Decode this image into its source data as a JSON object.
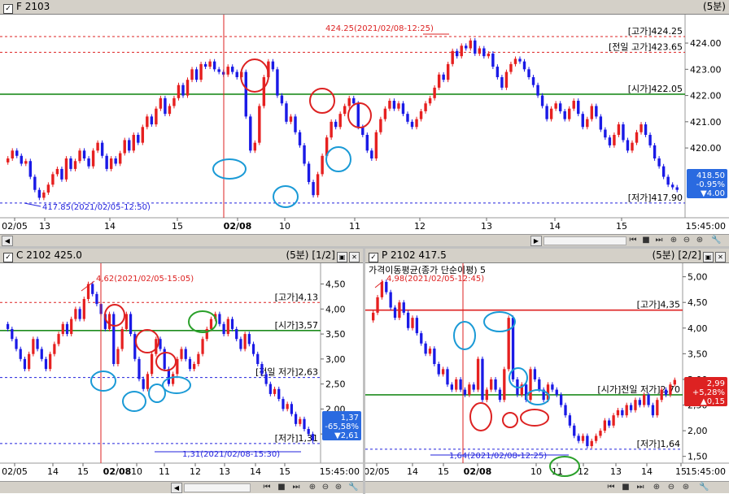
{
  "top": {
    "title": "F 2103",
    "interval": "(5분)",
    "colors": {
      "up": "#e62020",
      "down": "#1a1ae6",
      "open": "#1e8c1e",
      "high": "#dd2222",
      "low": "#2222dd"
    },
    "chart_data": {
      "type": "candlestick",
      "ylim": [
        417.4,
        424.9
      ],
      "yticks": [
        "424.00",
        "423.00",
        "422.00",
        "421.00",
        "420.00"
      ],
      "xticks": [
        "02/05",
        "13",
        "14",
        "15",
        "02/08",
        "10",
        "11",
        "12",
        "13",
        "14",
        "15"
      ],
      "time_label": "15:45:00",
      "levels": [
        {
          "label": "[고가]424.25",
          "value": 424.25,
          "color": "#dd2222",
          "style": "dot"
        },
        {
          "label": "[전일 고가]423.65",
          "value": 423.65,
          "color": "#dd2222",
          "style": "dot"
        },
        {
          "label": "[시가]422.05",
          "value": 422.05,
          "color": "#1e8c1e",
          "style": "solid"
        },
        {
          "label": "[저가]417.90",
          "value": 417.9,
          "color": "#2222dd",
          "style": "dot"
        }
      ],
      "annotations": [
        {
          "text": "424.25(2021/02/08-12:25)",
          "color": "#dd2222"
        },
        {
          "text": "417.85(2021/02/05-12:50)",
          "color": "#2222dd"
        }
      ],
      "price_tag": {
        "price": "418.50",
        "change_pct": "-0.95%",
        "change": "▼4.00"
      },
      "series_close": [
        419.6,
        419.9,
        419.7,
        419.4,
        419.5,
        418.9,
        418.4,
        418.1,
        418.3,
        418.6,
        419.0,
        419.2,
        418.8,
        419.6,
        419.2,
        419.5,
        419.9,
        419.6,
        419.3,
        419.9,
        420.2,
        419.7,
        419.2,
        419.6,
        419.4,
        419.8,
        420.3,
        419.9,
        420.5,
        420.2,
        420.8,
        421.2,
        420.9,
        421.5,
        421.9,
        421.3,
        421.6,
        421.9,
        422.4,
        422.0,
        422.6,
        423.0,
        422.6,
        423.2,
        423.1,
        423.3,
        423.0,
        422.9,
        422.8,
        423.1,
        422.9,
        422.7,
        422.9,
        421.2,
        419.9,
        420.2,
        421.6,
        422.7,
        423.3,
        423.0,
        422.0,
        421.7,
        421.0,
        421.2,
        420.6,
        420.1,
        419.4,
        418.7,
        418.2,
        419.0,
        419.7,
        420.4,
        421.0,
        420.8,
        421.3,
        421.6,
        421.9,
        421.7,
        420.8,
        420.5,
        419.9,
        419.6,
        420.6,
        421.1,
        421.5,
        421.8,
        421.5,
        421.7,
        421.3,
        421.0,
        420.8,
        421.1,
        421.4,
        421.7,
        421.9,
        422.3,
        422.8,
        422.6,
        423.2,
        423.7,
        423.5,
        423.9,
        423.8,
        424.1,
        423.6,
        423.8,
        423.5,
        423.6,
        423.1,
        422.7,
        422.3,
        422.9,
        423.2,
        423.4,
        423.3,
        423.0,
        422.7,
        422.4,
        422.0,
        421.6,
        421.1,
        421.5,
        421.7,
        421.4,
        421.1,
        421.5,
        421.8,
        421.3,
        420.8,
        421.1,
        421.6,
        421.2,
        420.7,
        420.4,
        420.1,
        420.5,
        420.9,
        420.3,
        419.9,
        420.2,
        420.6,
        420.9,
        420.5,
        420.1,
        419.6,
        419.3,
        418.9,
        418.6,
        418.5,
        418.4
      ]
    }
  },
  "left": {
    "title": "C 2102 425.0",
    "interval": "(5분)",
    "page": "[1/2]",
    "chart_data": {
      "type": "candlestick",
      "ylim": [
        0.95,
        4.85
      ],
      "yticks": [
        "4,50",
        "4,00",
        "3,50",
        "3,00",
        "2,50",
        "2,00",
        "1,50"
      ],
      "xticks": [
        "02/05",
        "14",
        "15",
        "02/08",
        "10",
        "11",
        "12",
        "13",
        "14",
        "15"
      ],
      "time_label": "15:45:00",
      "levels": [
        {
          "label": "[고가]4,13",
          "value": 4.13,
          "color": "#dd2222",
          "style": "dot"
        },
        {
          "label": "[시가]3,57",
          "value": 3.57,
          "color": "#1e8c1e",
          "style": "solid"
        },
        {
          "label": "[전일 저가]2,63",
          "value": 2.63,
          "color": "#2222dd",
          "style": "dot"
        },
        {
          "label": "[저가]1,31",
          "value": 1.31,
          "color": "#2222dd",
          "style": "dot"
        }
      ],
      "annotations": [
        {
          "text": "4,62(2021/02/05-15:05)",
          "color": "#dd2222"
        },
        {
          "text": "1,31(2021/02/08-15:30)",
          "color": "#2222dd"
        }
      ],
      "price_tag": {
        "price": "1,37",
        "change_pct": "-65,58%",
        "change": "▼2,61"
      },
      "series_close": [
        3.6,
        3.4,
        3.2,
        3.0,
        2.8,
        3.1,
        3.4,
        3.2,
        3.0,
        2.8,
        3.1,
        3.3,
        3.5,
        3.7,
        3.5,
        3.8,
        4.0,
        3.8,
        4.2,
        4.5,
        4.3,
        4.1,
        3.9,
        3.6,
        3.9,
        2.9,
        3.2,
        3.6,
        3.9,
        3.5,
        3.0,
        2.6,
        2.4,
        2.7,
        3.1,
        3.4,
        3.2,
        2.8,
        2.5,
        2.7,
        3.0,
        3.2,
        3.0,
        2.8,
        2.9,
        3.1,
        3.4,
        3.6,
        3.8,
        3.9,
        3.7,
        3.5,
        3.8,
        3.6,
        3.4,
        3.2,
        3.5,
        3.3,
        3.1,
        2.9,
        2.7,
        2.5,
        2.3,
        2.4,
        2.2,
        2.0,
        2.1,
        1.9,
        1.7,
        1.8,
        1.6,
        1.5,
        1.37
      ]
    }
  },
  "right": {
    "title": "P 2102 417.5",
    "interval": "(5분)",
    "page": "[2/2]",
    "overlay_label": "가격이동평균(종가 단순이평) 5",
    "chart_data": {
      "type": "candlestick",
      "ylim": [
        1.4,
        5.2
      ],
      "yticks": [
        "5,00",
        "4,50",
        "4,00",
        "3,50",
        "3,00",
        "2,50",
        "2,00",
        "1,50"
      ],
      "xticks": [
        "02/05",
        "14",
        "15",
        "02/08",
        "10",
        "11",
        "12",
        "13",
        "14",
        "15"
      ],
      "time_label": "15:45:00",
      "levels": [
        {
          "label": "[고가]4,35",
          "value": 4.35,
          "color": "#dd2222",
          "style": "solid"
        },
        {
          "label": "[시가]전일 저가]2,70",
          "value": 2.7,
          "color": "#1e8c1e",
          "style": "solid"
        },
        {
          "label": "[저가]1,64",
          "value": 1.64,
          "color": "#2222dd",
          "style": "dot"
        }
      ],
      "annotations": [
        {
          "text": "4,98(2021/02/05-12:45)",
          "color": "#dd2222"
        },
        {
          "text": "1,64(2021/02/08-12:25)",
          "color": "#2222dd"
        }
      ],
      "price_tag": {
        "price": "2,99",
        "change_pct": "+5,28%",
        "change": "▲0,15"
      },
      "series_close": [
        4.3,
        4.6,
        4.9,
        4.7,
        4.4,
        4.2,
        4.5,
        4.3,
        4.0,
        4.2,
        3.9,
        3.7,
        3.5,
        3.6,
        3.3,
        3.1,
        3.2,
        2.9,
        2.8,
        3.0,
        2.8,
        2.7,
        2.9,
        2.8,
        3.4,
        2.6,
        2.8,
        3.0,
        2.8,
        2.6,
        3.2,
        4.2,
        3.0,
        2.7,
        2.9,
        2.6,
        3.2,
        3.0,
        2.8,
        2.6,
        2.9,
        2.8,
        2.7,
        2.5,
        2.3,
        2.1,
        1.9,
        1.8,
        1.9,
        1.7,
        1.8,
        1.9,
        2.0,
        2.2,
        2.1,
        2.3,
        2.4,
        2.3,
        2.5,
        2.4,
        2.6,
        2.5,
        2.7,
        2.5,
        2.3,
        2.6,
        2.8,
        2.7,
        2.9,
        2.99
      ]
    }
  }
}
